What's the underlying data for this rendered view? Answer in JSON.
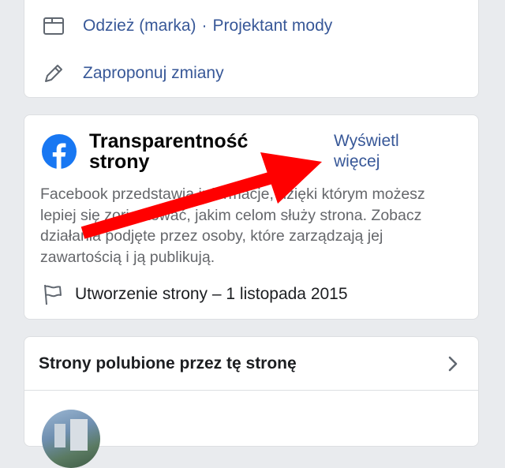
{
  "about": {
    "category": {
      "icon": "category-icon",
      "label1": "Odzież (marka)",
      "separator": "·",
      "label2": "Projektant mody"
    },
    "suggest": {
      "icon": "pencil-icon",
      "label": "Zaproponuj zmiany"
    }
  },
  "transparency": {
    "logo_icon": "facebook-logo-icon",
    "title": "Transparentność strony",
    "see_more": "Wyświetl więcej",
    "description": "Facebook przedstawia informacje, dzięki którym możesz lepiej się zorientować, jakim celom służy strona. Zobacz działania podjęte przez osoby, które zarządzają jej zawartością i ją publikują.",
    "created": {
      "icon": "flag-icon",
      "text": "Utworzenie strony – 1 listopada 2015"
    }
  },
  "liked_pages": {
    "title": "Strony polubione przez tę stronę",
    "chevron_icon": "chevron-right-icon"
  },
  "colors": {
    "link": "#385898",
    "facebook_blue": "#1877f2",
    "annotation_arrow": "#ff0000"
  }
}
